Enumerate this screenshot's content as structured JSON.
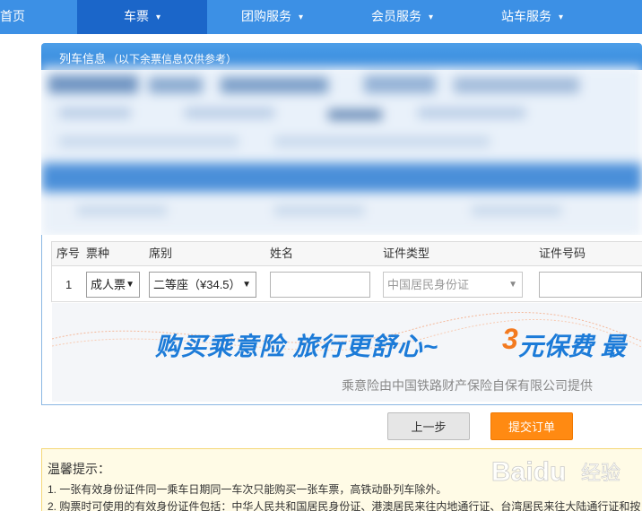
{
  "nav": {
    "items": [
      {
        "label": "首页",
        "has_dropdown": false,
        "active": false
      },
      {
        "label": "车票",
        "has_dropdown": true,
        "active": true
      },
      {
        "label": "团购服务",
        "has_dropdown": true,
        "active": false
      },
      {
        "label": "会员服务",
        "has_dropdown": true,
        "active": false
      },
      {
        "label": "站车服务",
        "has_dropdown": true,
        "active": false
      }
    ],
    "chevron": "▾"
  },
  "train_info": {
    "title": "列车信息",
    "note": "（以下余票信息仅供参考）"
  },
  "passengers": {
    "headers": [
      "序号",
      "票种",
      "席别",
      "姓名",
      "证件类型",
      "证件号码"
    ],
    "rows": [
      {
        "index": "1",
        "ticket_type": "成人票",
        "seat_class": "二等座（¥34.5）",
        "name": "",
        "id_type": "中国居民身份证",
        "id_number": ""
      }
    ]
  },
  "insurance": {
    "slogan": "购买乘意险  旅行更舒心~",
    "price_number": "3",
    "price_text": "元保费  最",
    "provider": "乘意险由中国铁路财产保险自保有限公司提供"
  },
  "buttons": {
    "prev": "上一步",
    "submit": "提交订单"
  },
  "tips": {
    "title": "温馨提示：",
    "lines": [
      "1. 一张有效身份证件同一乘车日期同一车次只能购买一张车票，高铁动卧列车除外。",
      "2. 购票时可使用的有效身份证件包括：中华人民共和国居民身份证、港澳居民来往内地通行证、台湾居民来往大陆通行证和按"
    ]
  },
  "watermark": {
    "brand": "Baidu",
    "suffix": "经验"
  },
  "colors": {
    "nav_bg": "#3c90e5",
    "nav_active": "#1b66c9",
    "panel_head": "#3286db",
    "accent_orange": "#ff8a12",
    "slogan_blue": "#1c7bd8"
  }
}
